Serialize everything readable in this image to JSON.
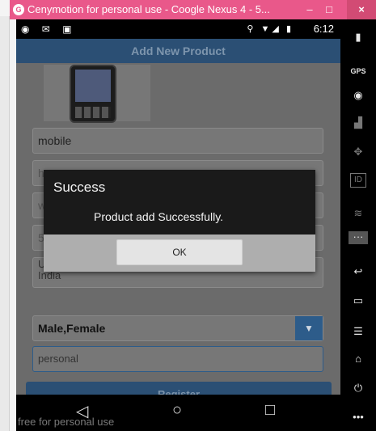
{
  "window": {
    "title": "Cenymotion for personal use - Coogle Nexus 4 - 5...",
    "minimize_glyph": "–",
    "maximize_glyph": "□",
    "close_glyph": "×"
  },
  "statusbar": {
    "left_icons": "◉ ✉ ▣",
    "right_icons": "⚲ ▼◢ ▮",
    "time": "6:12"
  },
  "actionbar": {
    "title": "Add New Product"
  },
  "form": {
    "name_value": "mobile",
    "field2_value": "h",
    "field3_value": "wardha",
    "field4_value": "5",
    "address_value": "Unnamed Road, Sawangi, Wardha, Maharashtra 442001, India",
    "gender_select": "Male,Female",
    "type_value": "personal",
    "register_label": "Register"
  },
  "dialog": {
    "title": "Success",
    "message": "Product add Successfully.",
    "ok_label": "OK"
  },
  "navbar": {
    "back_glyph": "◁",
    "home_glyph": "○",
    "recents_glyph": "□"
  },
  "watermark": "free for personal use",
  "sidebar": {
    "battery": "▮",
    "gps": "GPS",
    "webcam": "◉",
    "clapper": "▟",
    "dpad": "✥",
    "id": "ID",
    "rss": "≋",
    "menu_dots": "···",
    "back": "↩",
    "recent": "▭",
    "menu": "☰",
    "home": "⌂",
    "power": "⏻",
    "more": "•••"
  }
}
